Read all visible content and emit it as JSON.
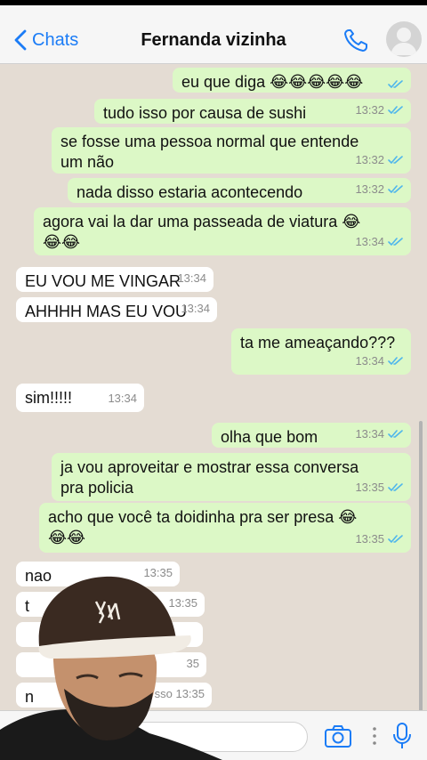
{
  "header": {
    "back_label": "Chats",
    "contact_name": "Fernanda vizinha"
  },
  "messages": [
    {
      "dir": "out",
      "text": "eu que diga 😂😂😂😂😂",
      "time": ""
    },
    {
      "dir": "out",
      "text": "tudo isso por causa de sushi",
      "time": "13:32"
    },
    {
      "dir": "out",
      "text": "se fosse uma pessoa normal que entende\num não",
      "time": "13:32"
    },
    {
      "dir": "out",
      "text": "nada disso estaria acontecendo",
      "time": "13:32"
    },
    {
      "dir": "out",
      "text": "agora vai la dar uma passeada de viatura 😂\n😂😂",
      "time": "13:34"
    },
    {
      "dir": "in",
      "text": "EU VOU ME VINGAR",
      "time": "13:34"
    },
    {
      "dir": "in",
      "text": "AHHHH MAS EU VOU",
      "time": "13:34"
    },
    {
      "dir": "out",
      "text": "ta me ameaçando???",
      "time": "13:34"
    },
    {
      "dir": "in",
      "text": "sim!!!!!",
      "time": "13:34"
    },
    {
      "dir": "out",
      "text": "olha que bom",
      "time": "13:34"
    },
    {
      "dir": "out",
      "text": "ja vou aproveitar e mostrar essa conversa\npra policia",
      "time": "13:35"
    },
    {
      "dir": "out",
      "text": "acho que você ta doidinha pra ser presa 😂\n😂😂",
      "time": "13:35"
    },
    {
      "dir": "in",
      "text": "nao",
      "time": "13:35"
    },
    {
      "dir": "in",
      "text": "t",
      "time": "13:35"
    },
    {
      "dir": "in",
      "text": "",
      "time": ""
    },
    {
      "dir": "in",
      "text": "",
      "time": "35"
    },
    {
      "dir": "in",
      "text": "n",
      "time": "sso 13:35"
    }
  ],
  "icons": {
    "back": "chevron-left-icon",
    "call": "phone-icon",
    "avatar": "default-avatar-icon",
    "camera": "camera-icon",
    "more": "vertical-dots-icon",
    "mic": "microphone-icon",
    "read": "double-check-icon"
  },
  "colors": {
    "accent": "#1b7cf6",
    "outgoing_bubble": "#dcf8c6",
    "incoming_bubble": "#ffffff",
    "chat_background": "#e4dcd3",
    "read_ticks": "#4fb6ec"
  }
}
